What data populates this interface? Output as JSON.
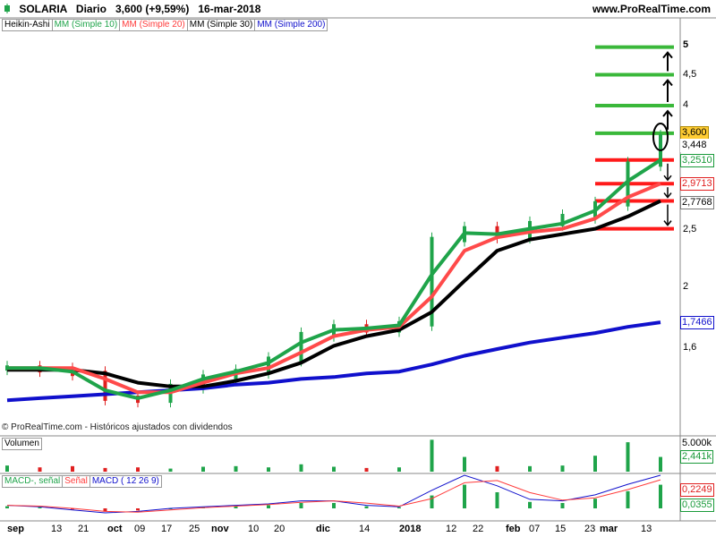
{
  "header": {
    "symbol_label": "SOLARIA",
    "period": "Diario",
    "last_value": "3,600 (+9,59%)",
    "date": "16-mar-2018",
    "site": "www.ProRealTime.com"
  },
  "legend": [
    "Heikin-Ashi",
    "MM (Simple 10)",
    "MM (Simple 20)",
    "MM (Simple 30)",
    "MM (Simple 200)"
  ],
  "legend_colors": [
    "#000000",
    "#1fa44a",
    "#ff3b3b",
    "#000000",
    "#1010cc"
  ],
  "credit": "© ProRealTime.com - Históricos ajustados con dividendos",
  "price_axis": {
    "labels": [
      "5",
      "4,5",
      "4",
      "2,5",
      "2",
      "1,6"
    ],
    "badges": [
      {
        "text": "3,600",
        "bg": "#ffcc33",
        "fg": "#000000"
      },
      {
        "text": "3,448",
        "bg": "#ffffff",
        "fg": "#000000"
      },
      {
        "text": "3,2510",
        "bg": "#ffffff",
        "fg": "#1a9a3a"
      },
      {
        "text": "2,9713",
        "bg": "#ffffff",
        "fg": "#e02020"
      },
      {
        "text": "2,7768",
        "bg": "#ffffff",
        "fg": "#000000"
      },
      {
        "text": "1,7466",
        "bg": "#ffffff",
        "fg": "#1010cc"
      }
    ]
  },
  "volume_panel": {
    "title": "Volumen",
    "labels": [
      "5.000k",
      "2,441k"
    ]
  },
  "macd_panel": {
    "legend": [
      "MACD-, señal",
      "Señal",
      "MACD ( 12 26 9)"
    ],
    "legend_colors": [
      "#1fa44a",
      "#ff3b3b",
      "#1010cc"
    ],
    "labels": [
      "0,2249",
      "0,0355"
    ]
  },
  "x_axis": {
    "labels": [
      "sep",
      "13",
      "21",
      "oct",
      "09",
      "17",
      "25",
      "nov",
      "10",
      "20",
      "dic",
      "14",
      "2018",
      "12",
      "22",
      "feb",
      "07",
      "15",
      "23",
      "mar",
      "13"
    ],
    "major": [
      "sep",
      "oct",
      "nov",
      "dic",
      "2018",
      "feb",
      "mar"
    ]
  },
  "colors": {
    "up": "#1fa44a",
    "down": "#e02020",
    "ma10": "#1fa44a",
    "ma20": "#ff4a4a",
    "ma30": "#000000",
    "ma200": "#1010cc"
  },
  "chart_data": {
    "type": "line",
    "title": "SOLARIA Diario",
    "x": [
      "sep",
      "13",
      "21",
      "oct",
      "09",
      "17",
      "25",
      "nov",
      "10",
      "20",
      "dic",
      "14",
      "2018",
      "12",
      "22",
      "feb",
      "07",
      "15",
      "23",
      "mar",
      "13"
    ],
    "y_scale": "log",
    "ylim": [
      1.37,
      5.4
    ],
    "series": [
      {
        "name": "Heikin-Ashi",
        "values": [
          1.47,
          1.46,
          1.44,
          1.31,
          1.3,
          1.37,
          1.42,
          1.45,
          1.52,
          1.67,
          1.72,
          1.7,
          1.74,
          2.4,
          2.5,
          2.43,
          2.55,
          2.62,
          2.75,
          3.2,
          3.55
        ]
      },
      {
        "name": "MM (Simple 10)",
        "values": [
          1.47,
          1.47,
          1.45,
          1.35,
          1.31,
          1.35,
          1.41,
          1.45,
          1.5,
          1.62,
          1.7,
          1.71,
          1.73,
          2.1,
          2.46,
          2.45,
          2.5,
          2.55,
          2.68,
          3.0,
          3.25
        ]
      },
      {
        "name": "MM (Simple 20)",
        "values": [
          1.47,
          1.47,
          1.47,
          1.41,
          1.34,
          1.34,
          1.39,
          1.44,
          1.47,
          1.56,
          1.66,
          1.7,
          1.72,
          1.93,
          2.3,
          2.42,
          2.47,
          2.5,
          2.6,
          2.82,
          2.97
        ]
      },
      {
        "name": "MM (Simple 30)",
        "values": [
          1.46,
          1.46,
          1.46,
          1.44,
          1.39,
          1.37,
          1.37,
          1.4,
          1.44,
          1.5,
          1.6,
          1.66,
          1.7,
          1.82,
          2.05,
          2.3,
          2.4,
          2.45,
          2.5,
          2.62,
          2.78
        ]
      },
      {
        "name": "MM (Simple 200)",
        "values": [
          1.3,
          1.31,
          1.32,
          1.33,
          1.34,
          1.35,
          1.36,
          1.38,
          1.39,
          1.41,
          1.42,
          1.44,
          1.45,
          1.49,
          1.54,
          1.58,
          1.62,
          1.65,
          1.68,
          1.72,
          1.75
        ]
      }
    ],
    "resistance_levels": [
      3.6,
      4.0,
      4.5,
      5.0
    ],
    "support_levels": [
      3.25,
      2.97,
      2.78,
      2.5
    ],
    "volume_k": [
      1000,
      700,
      900,
      600,
      700,
      500,
      800,
      900,
      700,
      1200,
      800,
      600,
      700,
      5200,
      2400,
      900,
      900,
      1000,
      2600,
      4800,
      2400
    ],
    "macd": [
      0.02,
      0.01,
      -0.01,
      -0.03,
      -0.02,
      0.0,
      0.01,
      0.02,
      0.03,
      0.05,
      0.05,
      0.02,
      0.01,
      0.12,
      0.22,
      0.15,
      0.06,
      0.05,
      0.09,
      0.16,
      0.22
    ]
  }
}
